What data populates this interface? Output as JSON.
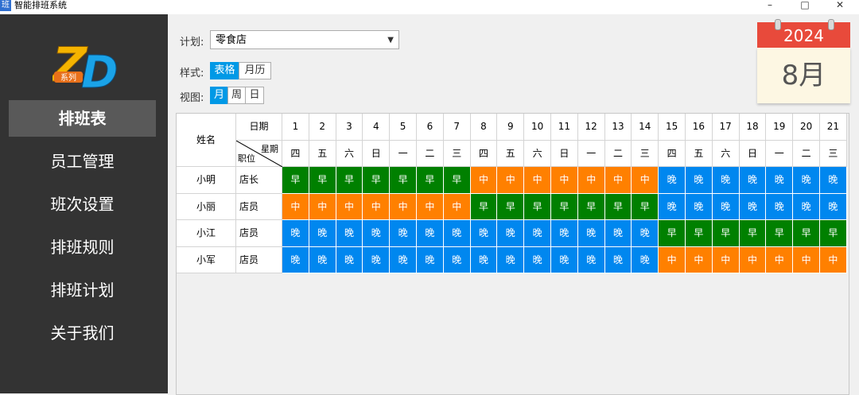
{
  "window": {
    "icon_text": "班",
    "title": "智能排班系统",
    "controls": [
      "–",
      "□",
      "✕"
    ]
  },
  "logo": {
    "letters": "ZD",
    "badge": "系列",
    "colors": {
      "z": "#f5b400",
      "d": "#1aa3e8",
      "badge": "#e8701a"
    }
  },
  "sidebar": {
    "items": [
      {
        "label": "排班表",
        "active": true
      },
      {
        "label": "员工管理"
      },
      {
        "label": "班次设置"
      },
      {
        "label": "排班规则"
      },
      {
        "label": "排班计划"
      },
      {
        "label": "关于我们"
      }
    ]
  },
  "form": {
    "plan_label": "计划:",
    "plan_value": "零食店",
    "style_label": "样式:",
    "style_options": [
      "表格",
      "月历"
    ],
    "style_selected": "表格",
    "view_label": "视图:",
    "view_options": [
      "月",
      "周",
      "日"
    ],
    "view_selected": "月"
  },
  "calendar": {
    "year": "2024",
    "month": "8月"
  },
  "table": {
    "name_header": "姓名",
    "date_header": "日期",
    "weekday_header": "星期",
    "position_header": "职位",
    "dates": [
      "1",
      "2",
      "3",
      "4",
      "5",
      "6",
      "7",
      "8",
      "9",
      "10",
      "11",
      "12",
      "13",
      "14",
      "15",
      "16",
      "17",
      "18",
      "19",
      "20",
      "21"
    ],
    "weekdays": [
      "四",
      "五",
      "六",
      "日",
      "一",
      "二",
      "三",
      "四",
      "五",
      "六",
      "日",
      "一",
      "二",
      "三",
      "四",
      "五",
      "六",
      "日",
      "一",
      "二",
      "三"
    ],
    "rows": [
      {
        "name": "小明",
        "position": "店长",
        "shifts": [
          "早",
          "早",
          "早",
          "早",
          "早",
          "早",
          "早",
          "中",
          "中",
          "中",
          "中",
          "中",
          "中",
          "中",
          "晚",
          "晚",
          "晚",
          "晚",
          "晚",
          "晚",
          "晚"
        ]
      },
      {
        "name": "小丽",
        "position": "店员",
        "shifts": [
          "中",
          "中",
          "中",
          "中",
          "中",
          "中",
          "中",
          "早",
          "早",
          "早",
          "早",
          "早",
          "早",
          "早",
          "晚",
          "晚",
          "晚",
          "晚",
          "晚",
          "晚",
          "晚"
        ]
      },
      {
        "name": "小江",
        "position": "店员",
        "shifts": [
          "晚",
          "晚",
          "晚",
          "晚",
          "晚",
          "晚",
          "晚",
          "晚",
          "晚",
          "晚",
          "晚",
          "晚",
          "晚",
          "晚",
          "早",
          "早",
          "早",
          "早",
          "早",
          "早",
          "早"
        ]
      },
      {
        "name": "小军",
        "position": "店员",
        "shifts": [
          "晚",
          "晚",
          "晚",
          "晚",
          "晚",
          "晚",
          "晚",
          "晚",
          "晚",
          "晚",
          "晚",
          "晚",
          "晚",
          "晚",
          "中",
          "中",
          "中",
          "中",
          "中",
          "中",
          "中"
        ]
      }
    ]
  },
  "shift_colors": {
    "早": "#008000",
    "中": "#ff8000",
    "晚": "#0087ef"
  }
}
